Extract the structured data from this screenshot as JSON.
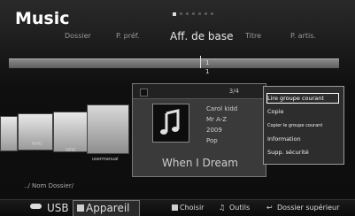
{
  "header": {
    "title": "Music",
    "page_count": 7,
    "current_page": 1
  },
  "tabs": [
    {
      "label": "Dossier",
      "active": false
    },
    {
      "label": "P. préf.",
      "active": false
    },
    {
      "label": "Aff. de base",
      "active": true
    },
    {
      "label": "Titre",
      "active": false
    },
    {
      "label": "P. artis.",
      "active": false
    }
  ],
  "timeline": {
    "marker_label": "1",
    "marker_label_below": "1"
  },
  "thumbnails": [
    {
      "label": ""
    },
    {
      "label": "NPKI"
    },
    {
      "label": "NPKI"
    },
    {
      "label": "usermanual"
    }
  ],
  "card": {
    "count": "3/4",
    "artist": "Carol kidd",
    "album": "Mr A-Z",
    "year": "2009",
    "genre": "Pop",
    "song_title": "When I Dream"
  },
  "context_menu": {
    "items": [
      {
        "label": "Lire groupe courant",
        "selected": true
      },
      {
        "label": "Copie",
        "selected": false
      },
      {
        "label": "Copier le groupe courant",
        "selected": false
      },
      {
        "label": "Information",
        "selected": false
      },
      {
        "label": "Supp. sécurité",
        "selected": false
      }
    ]
  },
  "path": "../ Nom Dossier/",
  "bottom_bar": {
    "usb_label": "USB",
    "device_label": "Appareil",
    "choose_label": "Choisir",
    "tools_label": "Outils",
    "up_label": "Dossier supérieur"
  },
  "colors": {
    "background": "#0d0d0d",
    "timeline": "#7a7a7a",
    "menu_bg": "#2d2d2d",
    "text": "#ffffff"
  }
}
